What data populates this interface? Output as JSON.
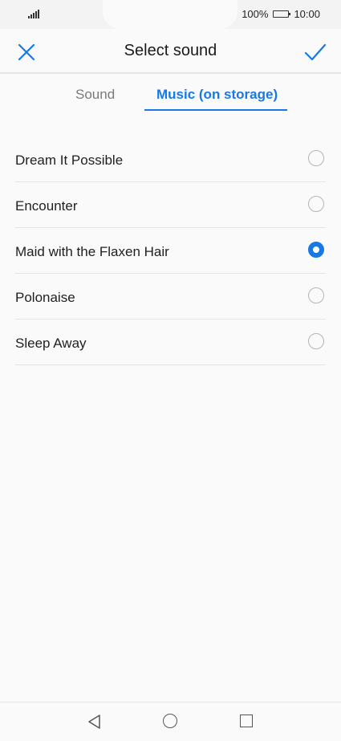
{
  "status_bar": {
    "battery": "100%",
    "time": "10:00"
  },
  "header": {
    "title": "Select sound"
  },
  "tabs": [
    {
      "label": "Sound",
      "active": false
    },
    {
      "label": "Music (on storage)",
      "active": true
    }
  ],
  "songs": [
    {
      "name": "Dream It Possible",
      "selected": false
    },
    {
      "name": "Encounter",
      "selected": false
    },
    {
      "name": "Maid with the Flaxen Hair",
      "selected": true
    },
    {
      "name": "Polonaise",
      "selected": false
    },
    {
      "name": "Sleep Away",
      "selected": false
    }
  ],
  "colors": {
    "accent": "#1879e6"
  },
  "icons": {
    "close": "close-icon",
    "confirm": "check-icon",
    "back": "back-triangle-icon",
    "home": "home-circle-icon",
    "recents": "recents-square-icon"
  }
}
